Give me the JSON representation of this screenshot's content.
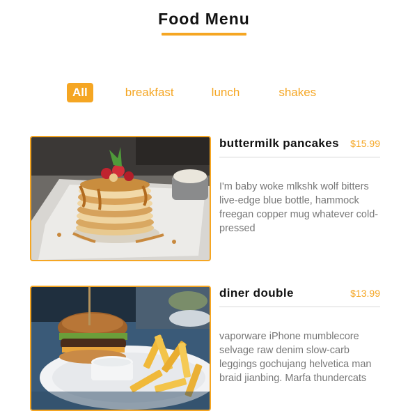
{
  "header": {
    "title": "Food Menu"
  },
  "filters": [
    "All",
    "breakfast",
    "lunch",
    "shakes"
  ],
  "items": [
    {
      "name": "buttermilk pancakes",
      "price": "$15.99",
      "description": "I'm baby woke mlkshk wolf bitters live-edge blue bottle, hammock freegan copper mug whatever cold-pressed"
    },
    {
      "name": "diner double",
      "price": "$13.99",
      "description": "vaporware iPhone mumblecore selvage raw denim slow-carb leggings gochujang helvetica man braid jianbing. Marfa thundercats"
    }
  ],
  "colors": {
    "accent": "#f5a623",
    "text": "#111111",
    "muted": "#777777"
  }
}
